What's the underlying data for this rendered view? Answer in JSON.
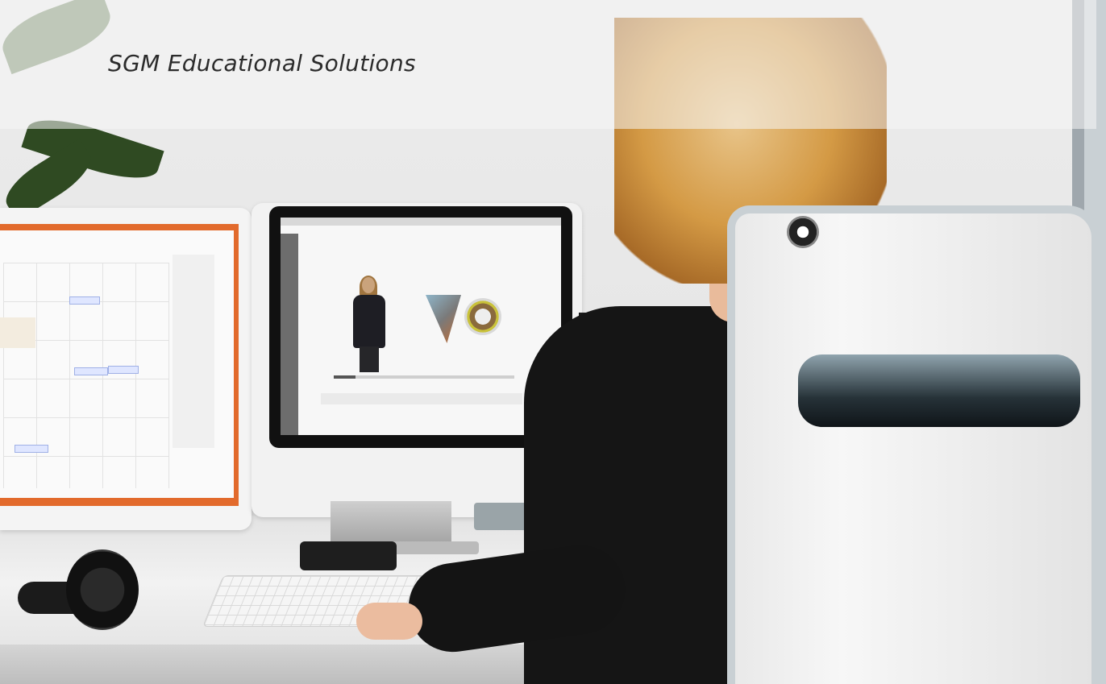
{
  "header": {
    "title": "SGM Educational Solutions"
  },
  "scene": {
    "colors": {
      "wall": "#e9e9e9",
      "accent_orange": "#e26a2c",
      "hair": "#d49a45",
      "sweater": "#151515"
    },
    "center_monitor": {
      "video_progress_percent": 12
    }
  }
}
